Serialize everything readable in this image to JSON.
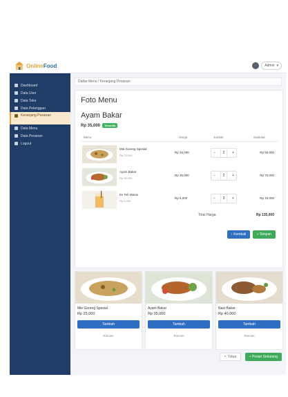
{
  "header": {
    "brand_part1": "Online",
    "brand_part2": "Food",
    "user_name": "Admin"
  },
  "sidebar": {
    "items": [
      {
        "label": "Dashboard",
        "active": false
      },
      {
        "label": "Data User",
        "active": false
      },
      {
        "label": "Data Toko",
        "active": false
      },
      {
        "label": "Data Pelanggan",
        "active": false
      },
      {
        "label": "Keranjang Pesanan",
        "active": true
      },
      {
        "label": "Data Menu",
        "active": false
      },
      {
        "label": "Data Pesanan",
        "active": false
      },
      {
        "label": "Logout",
        "active": false
      }
    ]
  },
  "breadcrumb": "Daftar Menu / Keranjang Pesanan",
  "menu": {
    "title": "Foto Menu",
    "food_name": "Ayam Bakar",
    "price": "Rp 35,000",
    "badge": "Tersedia"
  },
  "table": {
    "headers": {
      "menu": "Menu",
      "harga": "Harga",
      "jumlah": "Jumlah",
      "subtotal": "Subtotal"
    },
    "rows": [
      {
        "name": "Mie Goreng Spesial",
        "unit_price": "Rp 25,000",
        "price": "Rp 25,000",
        "qty": "2",
        "subtotal": "Rp 50,000"
      },
      {
        "name": "Ayam Bakar",
        "unit_price": "Rp 35,000",
        "price": "Rp 35,000",
        "qty": "2",
        "subtotal": "Rp 70,000"
      },
      {
        "name": "Es Teh Manis",
        "unit_price": "Rp 5,000",
        "price": "Rp 5,000",
        "qty": "3",
        "subtotal": "Rp 15,000"
      }
    ],
    "total_label": "Total Harga",
    "total_value": "Rp 135,000"
  },
  "buttons": {
    "back": "Kembali",
    "save": "Simpan",
    "close": "Tutup",
    "order": "Pesan Sekarang"
  },
  "food_cards": [
    {
      "name": "Mie Goreng Spesial",
      "price": "Rp 25,000",
      "add": "Tambah",
      "detail": "Rincian"
    },
    {
      "name": "Ayam Bakar",
      "price": "Rp 35,000",
      "add": "Tambah",
      "detail": "Rincian"
    },
    {
      "name": "Nasi Bakar",
      "price": "Rp 40,000",
      "add": "Tambah",
      "detail": "Rincian"
    }
  ]
}
